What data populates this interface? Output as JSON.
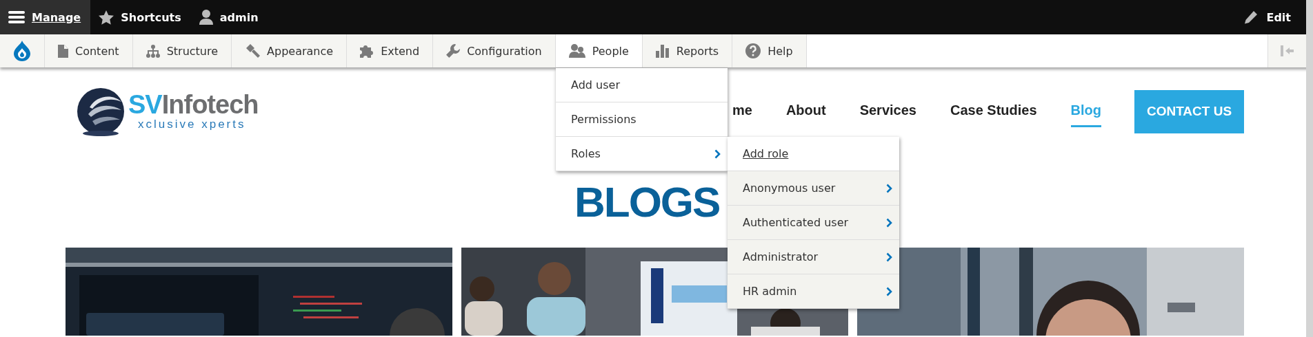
{
  "toolbar": {
    "items": [
      {
        "label": "Manage",
        "kind": "menu",
        "selected": true
      },
      {
        "label": "Shortcuts",
        "kind": "star",
        "selected": false
      },
      {
        "label": "admin",
        "kind": "user",
        "selected": false
      }
    ],
    "edit": {
      "label": "Edit"
    }
  },
  "tray": {
    "items": [
      {
        "label": "Content",
        "kind": "file",
        "selected": false
      },
      {
        "label": "Structure",
        "kind": "sitemap",
        "selected": false
      },
      {
        "label": "Appearance",
        "kind": "hammer",
        "selected": false
      },
      {
        "label": "Extend",
        "kind": "puzzle",
        "selected": false
      },
      {
        "label": "Configuration",
        "kind": "wrench",
        "selected": false
      },
      {
        "label": "People",
        "kind": "people",
        "selected": true
      },
      {
        "label": "Reports",
        "kind": "chart",
        "selected": false
      },
      {
        "label": "Help",
        "kind": "help",
        "selected": false
      }
    ]
  },
  "people_menu": {
    "items": [
      {
        "label": "Add user",
        "has_submenu": false,
        "expanded": false
      },
      {
        "label": "Permissions",
        "has_submenu": false,
        "expanded": false
      },
      {
        "label": "Roles",
        "has_submenu": true,
        "expanded": true
      }
    ]
  },
  "roles_submenu": {
    "items": [
      {
        "label": "Add role",
        "has_submenu": false,
        "selected": true
      },
      {
        "label": "Anonymous user",
        "has_submenu": true,
        "selected": false
      },
      {
        "label": "Authenticated user",
        "has_submenu": true,
        "selected": false
      },
      {
        "label": "Administrator",
        "has_submenu": true,
        "selected": false
      },
      {
        "label": "HR admin",
        "has_submenu": true,
        "selected": false
      }
    ]
  },
  "site": {
    "logo": {
      "wordmark": [
        "SV",
        "Infotech"
      ],
      "tagline": "xclusive xperts"
    },
    "nav": [
      {
        "label": "me",
        "selected": false
      },
      {
        "label": "About",
        "selected": false
      },
      {
        "label": "Services",
        "selected": false
      },
      {
        "label": "Case Studies",
        "selected": false
      },
      {
        "label": "Blog",
        "selected": true
      }
    ],
    "cta": "CONTACT US",
    "title": "BLOGS"
  }
}
